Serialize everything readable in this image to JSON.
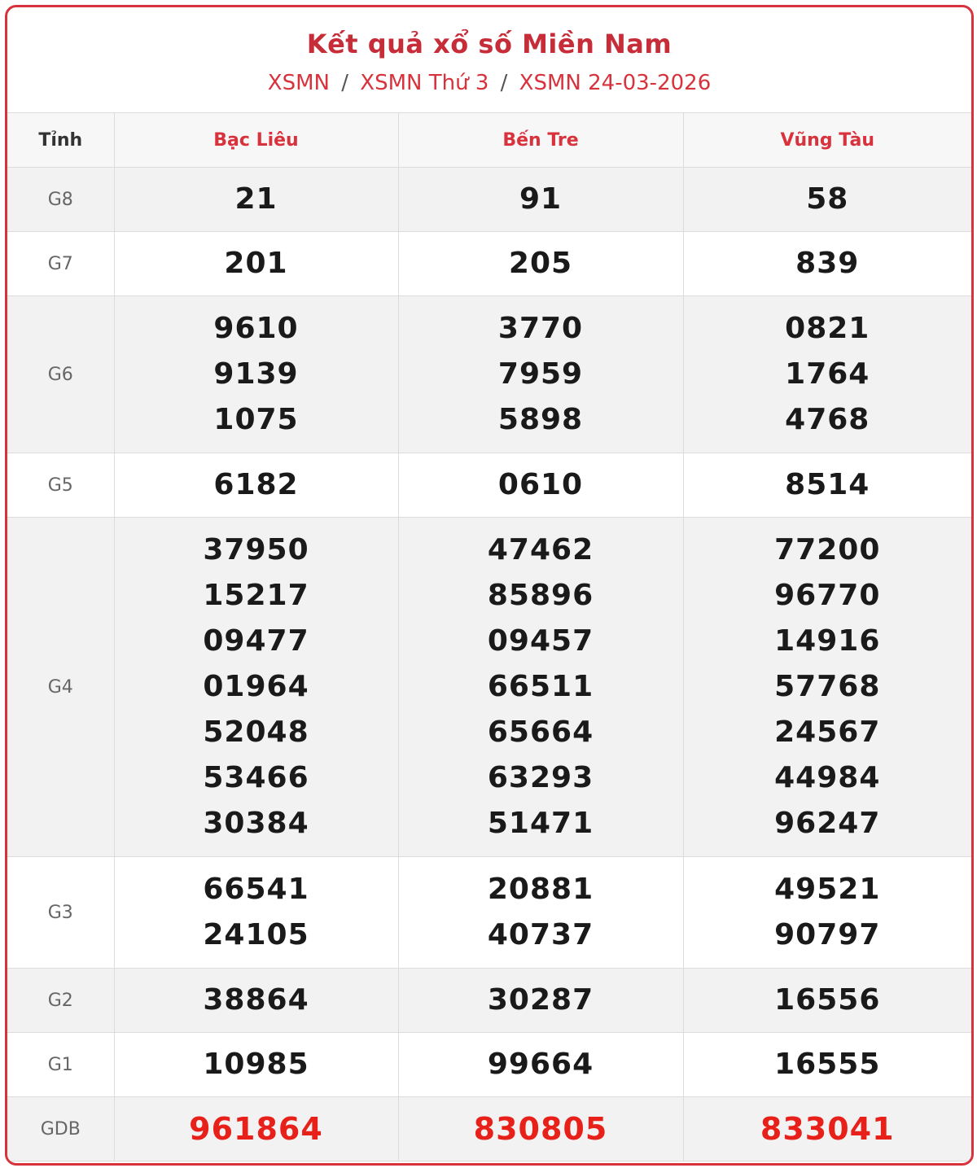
{
  "title": "Kết quả xổ số Miền Nam",
  "breadcrumb": [
    {
      "label": "XSMN"
    },
    {
      "label": "XSMN Thứ 3"
    },
    {
      "label": "XSMN 24-03-2026"
    }
  ],
  "breadcrumb_sep": "/",
  "table": {
    "header_label": "Tỉnh",
    "provinces": [
      "Bạc Liêu",
      "Bến Tre",
      "Vũng Tàu"
    ],
    "prizes": [
      {
        "label": "G8",
        "values": [
          [
            "21"
          ],
          [
            "91"
          ],
          [
            "58"
          ]
        ]
      },
      {
        "label": "G7",
        "values": [
          [
            "201"
          ],
          [
            "205"
          ],
          [
            "839"
          ]
        ]
      },
      {
        "label": "G6",
        "values": [
          [
            "9610",
            "9139",
            "1075"
          ],
          [
            "3770",
            "7959",
            "5898"
          ],
          [
            "0821",
            "1764",
            "4768"
          ]
        ]
      },
      {
        "label": "G5",
        "values": [
          [
            "6182"
          ],
          [
            "0610"
          ],
          [
            "8514"
          ]
        ]
      },
      {
        "label": "G4",
        "values": [
          [
            "37950",
            "15217",
            "09477",
            "01964",
            "52048",
            "53466",
            "30384"
          ],
          [
            "47462",
            "85896",
            "09457",
            "66511",
            "65664",
            "63293",
            "51471"
          ],
          [
            "77200",
            "96770",
            "14916",
            "57768",
            "24567",
            "44984",
            "96247"
          ]
        ]
      },
      {
        "label": "G3",
        "values": [
          [
            "66541",
            "24105"
          ],
          [
            "20881",
            "40737"
          ],
          [
            "49521",
            "90797"
          ]
        ]
      },
      {
        "label": "G2",
        "values": [
          [
            "38864"
          ],
          [
            "30287"
          ],
          [
            "16556"
          ]
        ]
      },
      {
        "label": "G1",
        "values": [
          [
            "10985"
          ],
          [
            "99664"
          ],
          [
            "16555"
          ]
        ]
      },
      {
        "label": "GDB",
        "values": [
          [
            "961864"
          ],
          [
            "830805"
          ],
          [
            "833041"
          ]
        ]
      }
    ]
  },
  "colors": {
    "accent": "#d8323c",
    "special_prize": "#e8201a"
  }
}
